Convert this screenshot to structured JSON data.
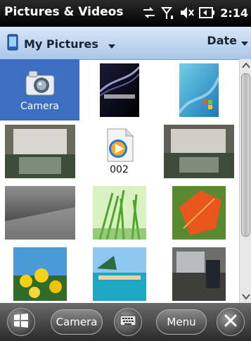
{
  "app": {
    "title": "Pictures & Videos",
    "time": "2:14"
  },
  "status_icons": [
    "sync-icon",
    "signal-icon",
    "volume-muted-icon",
    "battery-icon"
  ],
  "header": {
    "folder_label": "My Pictures",
    "sort_label": "Date"
  },
  "grid": {
    "items": [
      {
        "name": "camera-tile",
        "caption": "Camera",
        "kind": "camera-icon",
        "selected": true
      },
      {
        "name": "thumb-catchwell",
        "caption": "",
        "kind": "photo"
      },
      {
        "name": "thumb-windows-wallpaper",
        "caption": "",
        "kind": "photo"
      },
      {
        "name": "thumb-room-1",
        "caption": "",
        "kind": "photo"
      },
      {
        "name": "video-002",
        "caption": "002",
        "kind": "media-player-icon"
      },
      {
        "name": "thumb-room-2",
        "caption": "",
        "kind": "photo"
      },
      {
        "name": "thumb-gray-blur",
        "caption": "",
        "kind": "photo"
      },
      {
        "name": "thumb-green-grass",
        "caption": "",
        "kind": "photo"
      },
      {
        "name": "thumb-autumn-leaf",
        "caption": "",
        "kind": "photo"
      },
      {
        "name": "thumb-yellow-flowers",
        "caption": "",
        "kind": "photo"
      },
      {
        "name": "thumb-beach-pool",
        "caption": "",
        "kind": "photo"
      },
      {
        "name": "thumb-room-3",
        "caption": "",
        "kind": "photo"
      }
    ]
  },
  "softkeys": {
    "camera_label": "Camera",
    "menu_label": "Menu"
  },
  "colors": {
    "selection": "#3c6fc2",
    "header_top": "#d8e8f8",
    "header_bottom": "#a9c7e8"
  }
}
